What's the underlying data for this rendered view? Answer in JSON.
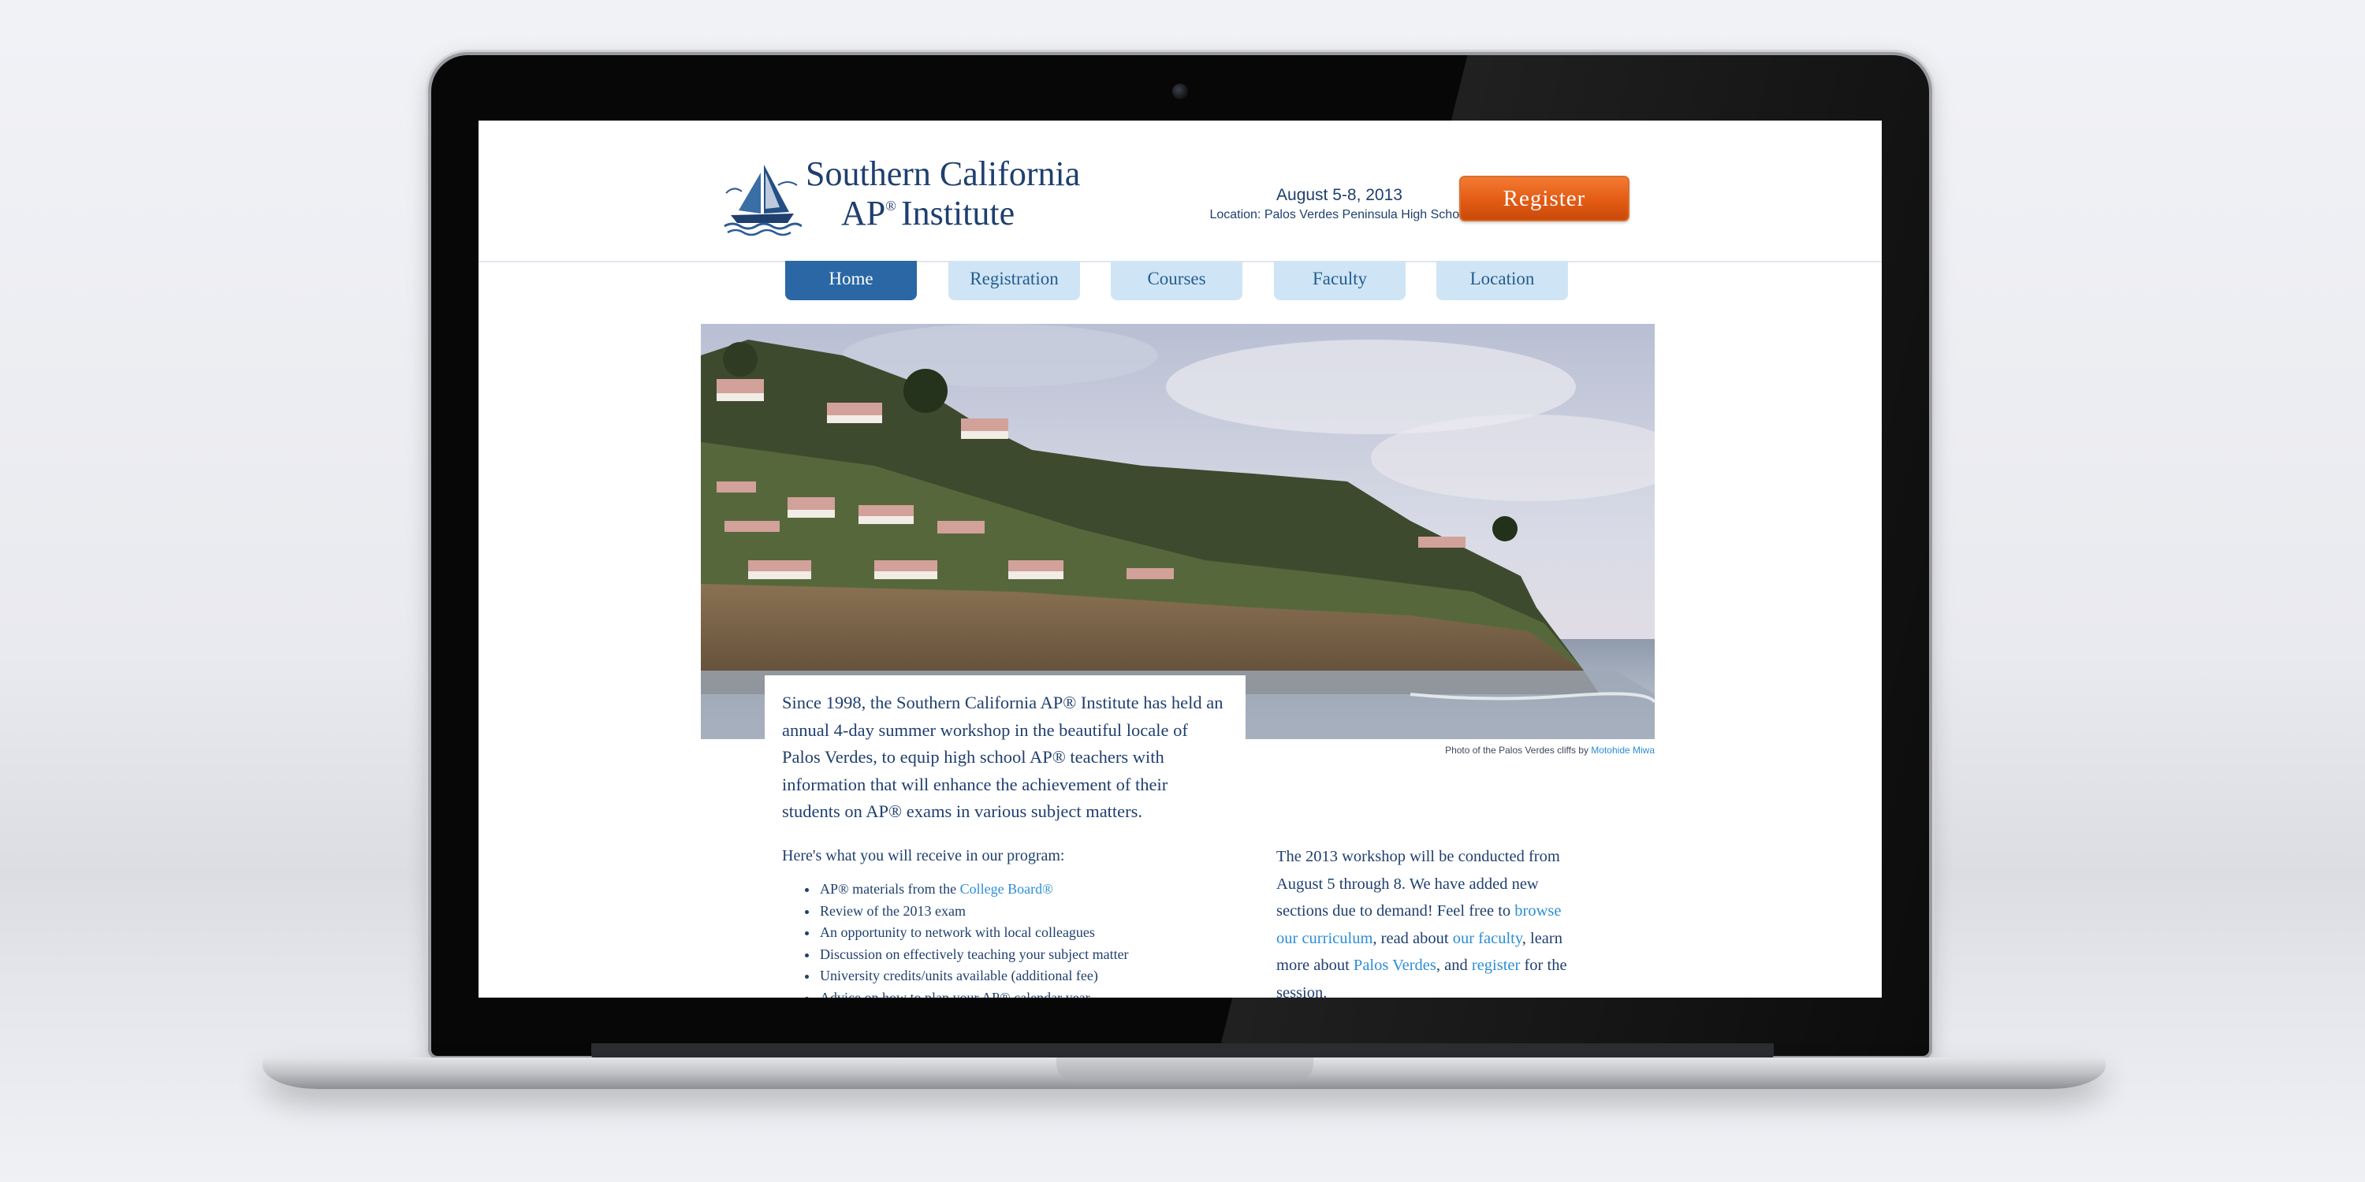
{
  "site": {
    "logo_line1": "Southern California",
    "logo_line2_prefix": "AP",
    "logo_line2_mark": "®",
    "logo_line2_suffix": "Institute",
    "event_date": "August 5-8, 2013",
    "event_location": "Location: Palos Verdes Peninsula High School",
    "register_label": "Register"
  },
  "nav": {
    "tabs": [
      {
        "label": "Home",
        "active": true
      },
      {
        "label": "Registration",
        "active": false
      },
      {
        "label": "Courses",
        "active": false
      },
      {
        "label": "Faculty",
        "active": false
      },
      {
        "label": "Location",
        "active": false
      }
    ]
  },
  "hero": {
    "credit_text": "Photo of the Palos Verdes cliffs by ",
    "credit_link": "Motohide Miwa"
  },
  "intro": {
    "text": "Since 1998, the Southern California AP® Institute has held an annual 4-day summer workshop in the beautiful locale of Palos Verdes, to equip high school AP® teachers with information that will enhance the achievement of their students on AP® exams in various subject matters."
  },
  "program": {
    "title": "Here's what you will receive in our program:",
    "item1_text": "AP® materials from the ",
    "item1_link": "College Board®",
    "items": [
      "Review of the 2013 exam",
      "An opportunity to network with local colleagues",
      "Discussion on effectively teaching your subject matter",
      "University credits/units available (additional fee)",
      "Advice on how to plan your AP® calendar year"
    ]
  },
  "workshop": {
    "part1": "The 2013 workshop will be conducted from August 5 through 8. We have added new sections due to demand! Feel free to ",
    "link1": "browse our curriculum",
    "part2": ", read about ",
    "link2": "our faculty",
    "part3": ", learn more about ",
    "link3": "Palos Verdes",
    "part4": ", and ",
    "link4": "register",
    "part5": " for the session."
  },
  "colors": {
    "navy_text": "#1f3f6e",
    "link_blue": "#2c8ed6",
    "nav_active": "#2a67a4",
    "nav_inactive": "#cfe5f6",
    "register_orange": "#e35b14"
  }
}
